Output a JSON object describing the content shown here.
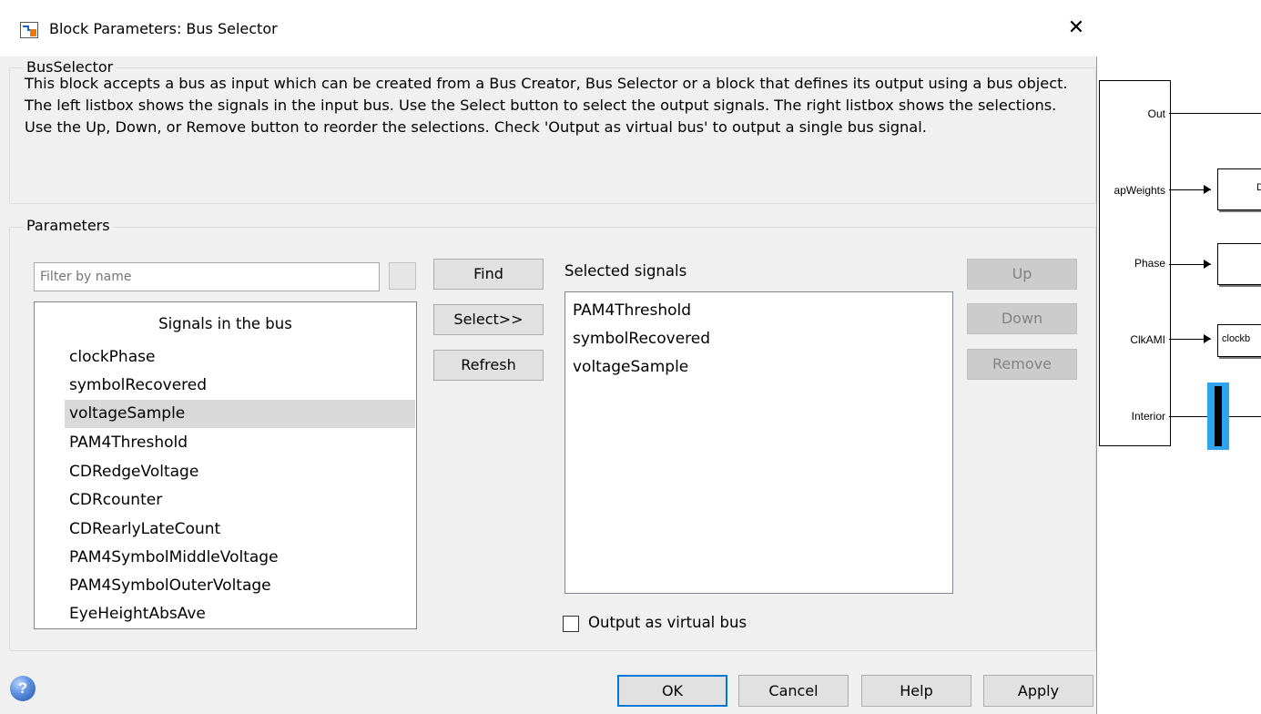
{
  "dialog": {
    "title": "Block Parameters: Bus Selector",
    "close_glyph": "✕",
    "section_label": "BusSelector",
    "description": "This block accepts a bus as input which can be created from a Bus Creator, Bus Selector or a block that defines its output using a bus object. The left listbox shows the signals in the input bus. Use the Select button to select the output signals. The right listbox shows the selections. Use the Up, Down, or Remove button to reorder the selections. Check 'Output as virtual bus' to output a single bus signal.",
    "parameters_label": "Parameters"
  },
  "filter": {
    "placeholder": "Filter by name"
  },
  "buttons": {
    "find": "Find",
    "select": "Select>>",
    "refresh": "Refresh",
    "up": "Up",
    "down": "Down",
    "remove": "Remove",
    "ok": "OK",
    "cancel": "Cancel",
    "help": "Help",
    "apply": "Apply"
  },
  "signals_list": {
    "header": "Signals in the bus",
    "items": [
      "clockPhase",
      "symbolRecovered",
      "voltageSample",
      "PAM4Threshold",
      "CDRedgeVoltage",
      "CDRcounter",
      "CDRearlyLateCount",
      "PAM4SymbolMiddleVoltage",
      "PAM4SymbolOuterVoltage",
      "EyeHeightAbsAve"
    ],
    "selected_item": "voltageSample"
  },
  "selected_signals": {
    "label": "Selected signals",
    "items": [
      "PAM4Threshold",
      "symbolRecovered",
      "voltageSample"
    ]
  },
  "output_virtual_bus": {
    "label": "Output as virtual bus",
    "checked": false
  },
  "help_icon_glyph": "?",
  "diagram": {
    "ports": [
      "Out",
      "apWeights",
      "Phase",
      "ClkAMI",
      "Interior"
    ],
    "blocks": [
      "D",
      "",
      "clockb"
    ]
  },
  "colors": {
    "accent": "#0078d7",
    "selection": "#d9d9d9",
    "bus_highlight": "#2ea3ee"
  }
}
